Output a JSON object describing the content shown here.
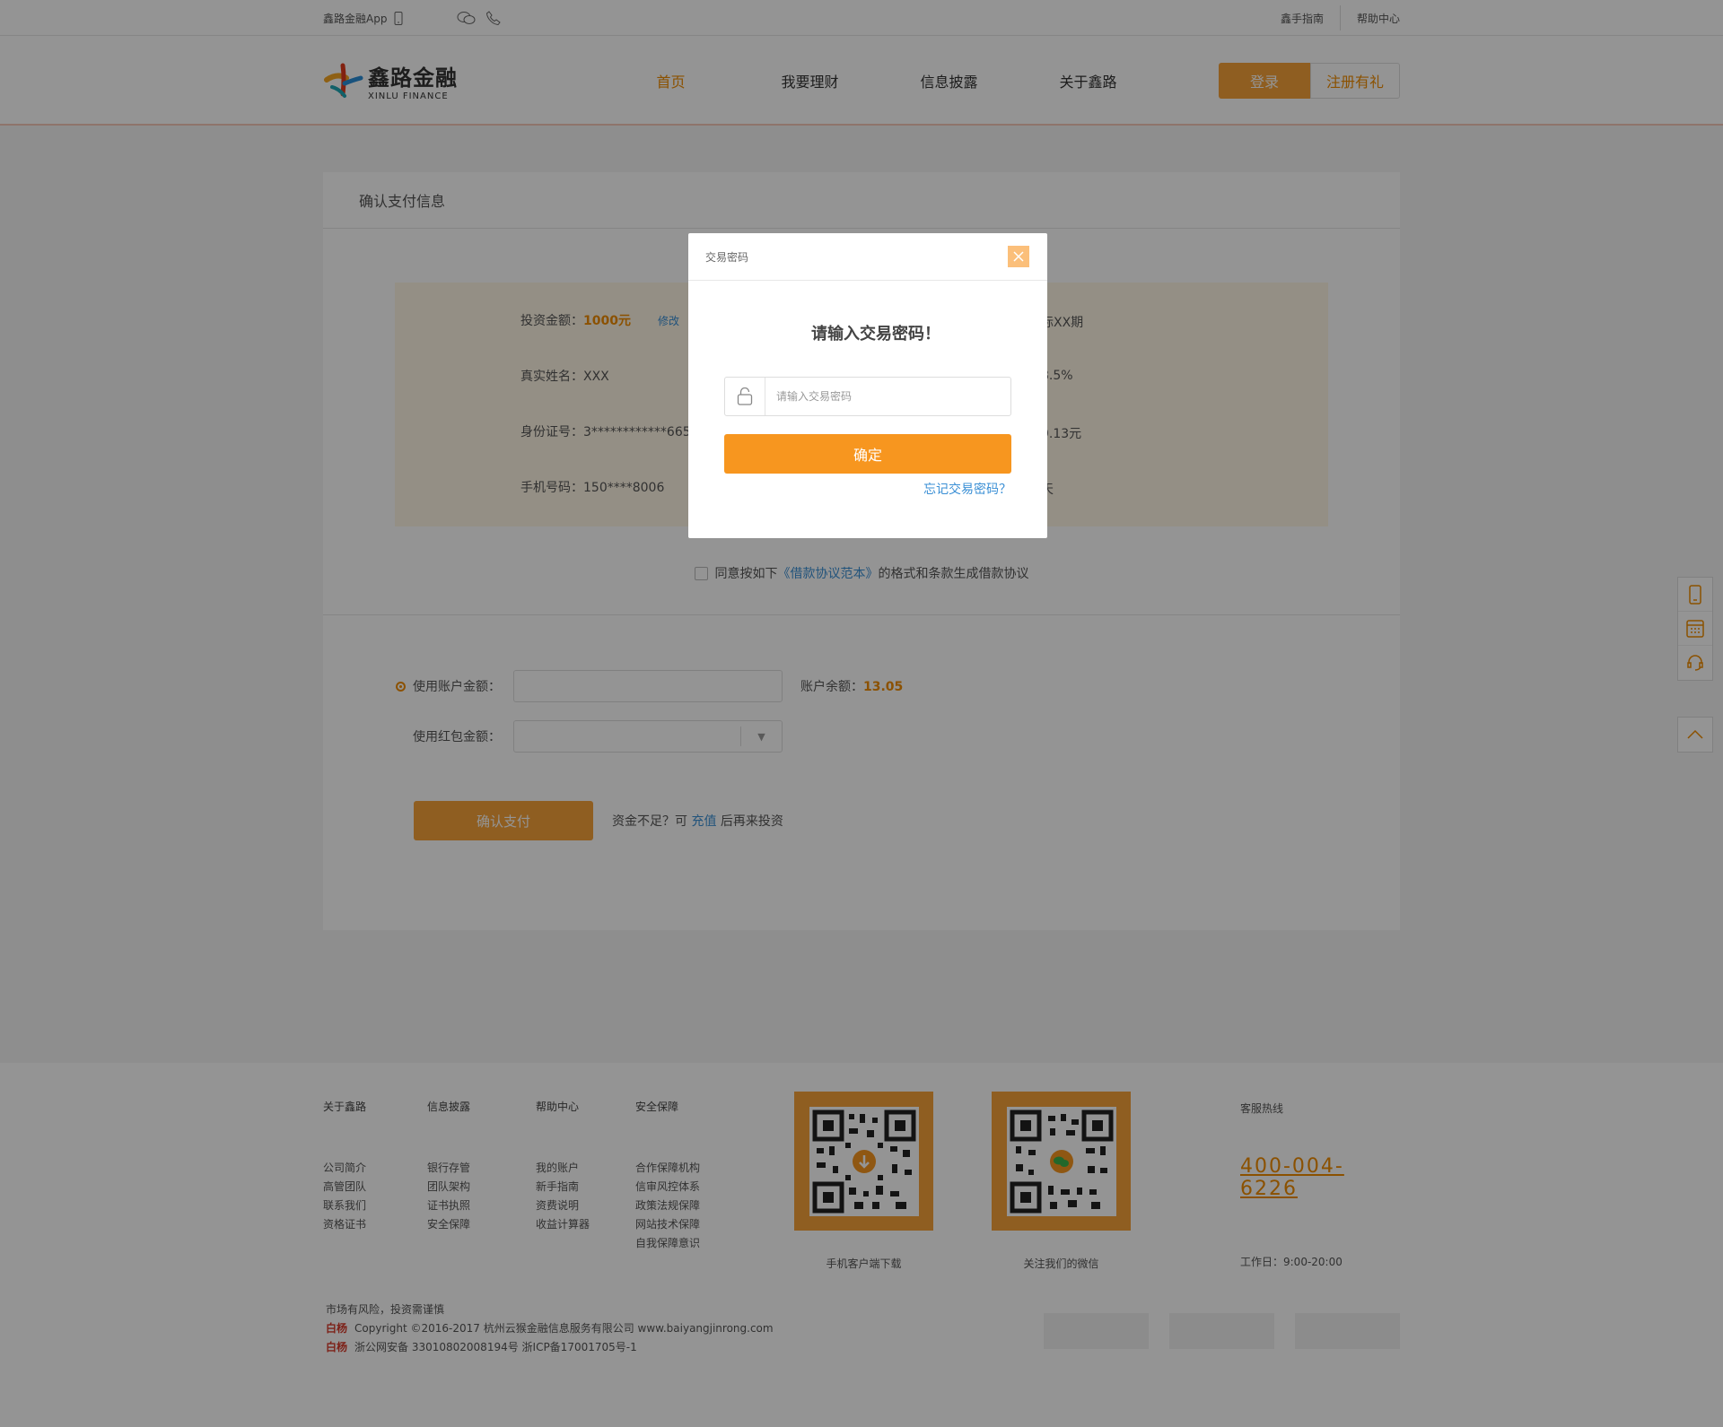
{
  "topbar": {
    "app_label": "鑫路金融App",
    "guide": "鑫手指南",
    "help": "帮助中心"
  },
  "header": {
    "logo_cn": "鑫路金融",
    "logo_en": "XINLU FINANCE",
    "nav": [
      "首页",
      "我要理财",
      "信息披露",
      "关于鑫路"
    ],
    "login": "登录",
    "register": "注册有礼"
  },
  "panel": {
    "title": "确认支付信息",
    "invest_label": "投资金额：",
    "invest_value": "1000元",
    "modify": "修改",
    "name_label": "真实姓名：",
    "name_value": "XXX",
    "id_label": "身份证号：",
    "id_value": "3************665",
    "phone_label": "手机号码：",
    "phone_value": "150****8006",
    "right_col": [
      "标XX期",
      "8.5%",
      "9.13元",
      "天"
    ],
    "agree_prefix": "同意按如下",
    "agree_link": "《借款协议范本》",
    "agree_suffix": "的格式和条款生成借款协议",
    "use_balance_label": "使用账户金额：",
    "balance_label": "账户余额：",
    "balance_value": "13.05",
    "use_redpack_label": "使用红包金额：",
    "pay_button": "确认支付",
    "pay_note_prefix": "资金不足？可",
    "pay_note_link": "充值",
    "pay_note_suffix": "后再来投资"
  },
  "modal": {
    "header": "交易密码",
    "title": "请输入交易密码！",
    "placeholder": "请输入交易密码",
    "ok": "确定",
    "forgot": "忘记交易密码？"
  },
  "footer": {
    "cols": [
      {
        "title": "关于鑫路",
        "items": [
          "公司简介",
          "高管团队",
          "联系我们",
          "资格证书"
        ]
      },
      {
        "title": "信息披露",
        "items": [
          "银行存管",
          "团队架构",
          "证书执照",
          "安全保障"
        ]
      },
      {
        "title": "帮助中心",
        "items": [
          "我的账户",
          "新手指南",
          "资费说明",
          "收益计算器"
        ]
      },
      {
        "title": "安全保障",
        "items": [
          "合作保障机构",
          "信审风控体系",
          "政策法规保障",
          "网站技术保障",
          "自我保障意识"
        ]
      }
    ],
    "qr1_caption": "手机客户端下载",
    "qr2_caption": "关注我们的微信",
    "hotline_label": "客服热线",
    "hotline": "400-004-6226",
    "hours": "工作日：9:00-20:00",
    "risk": "市场有风险，投资需谨慎",
    "brand": "白杨",
    "copyright": "Copyright ©2016-2017 杭州云猴金融信息服务有限公司 www.baiyangjinrong.com",
    "icp": "浙公网安备 33010802008194号 浙ICP备17001705号-1"
  },
  "colors": {
    "accent": "#f7961f",
    "link": "#3a8fd5",
    "brand_red": "#d83a2a"
  }
}
